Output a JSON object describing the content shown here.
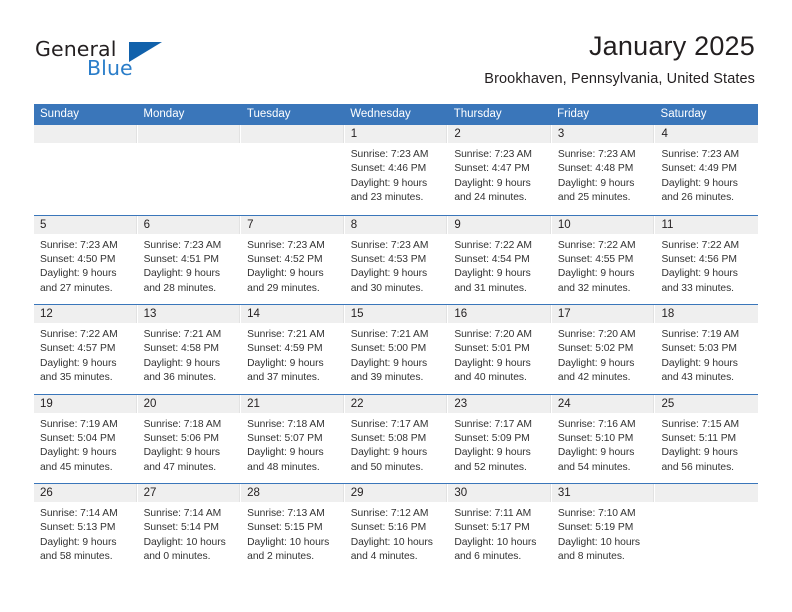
{
  "brand": {
    "name_part1": "General",
    "name_part2": "Blue",
    "logo_icon": "blue-triangle-icon",
    "color_dark": "#231f20",
    "color_blue": "#2a7dc9",
    "color_triangle": "#1161ab"
  },
  "header": {
    "title": "January 2025",
    "subtitle": "Brookhaven, Pennsylvania, United States"
  },
  "theme": {
    "header_blue": "#3a76ba",
    "daynum_band": "#efefef",
    "text": "#333333"
  },
  "calendar": {
    "weekday_headers": [
      "Sunday",
      "Monday",
      "Tuesday",
      "Wednesday",
      "Thursday",
      "Friday",
      "Saturday"
    ],
    "weeks": [
      [
        {
          "empty": true
        },
        {
          "empty": true
        },
        {
          "empty": true
        },
        {
          "day": "1",
          "sunrise": "Sunrise: 7:23 AM",
          "sunset": "Sunset: 4:46 PM",
          "daylight1": "Daylight: 9 hours",
          "daylight2": "and 23 minutes."
        },
        {
          "day": "2",
          "sunrise": "Sunrise: 7:23 AM",
          "sunset": "Sunset: 4:47 PM",
          "daylight1": "Daylight: 9 hours",
          "daylight2": "and 24 minutes."
        },
        {
          "day": "3",
          "sunrise": "Sunrise: 7:23 AM",
          "sunset": "Sunset: 4:48 PM",
          "daylight1": "Daylight: 9 hours",
          "daylight2": "and 25 minutes."
        },
        {
          "day": "4",
          "sunrise": "Sunrise: 7:23 AM",
          "sunset": "Sunset: 4:49 PM",
          "daylight1": "Daylight: 9 hours",
          "daylight2": "and 26 minutes."
        }
      ],
      [
        {
          "day": "5",
          "sunrise": "Sunrise: 7:23 AM",
          "sunset": "Sunset: 4:50 PM",
          "daylight1": "Daylight: 9 hours",
          "daylight2": "and 27 minutes."
        },
        {
          "day": "6",
          "sunrise": "Sunrise: 7:23 AM",
          "sunset": "Sunset: 4:51 PM",
          "daylight1": "Daylight: 9 hours",
          "daylight2": "and 28 minutes."
        },
        {
          "day": "7",
          "sunrise": "Sunrise: 7:23 AM",
          "sunset": "Sunset: 4:52 PM",
          "daylight1": "Daylight: 9 hours",
          "daylight2": "and 29 minutes."
        },
        {
          "day": "8",
          "sunrise": "Sunrise: 7:23 AM",
          "sunset": "Sunset: 4:53 PM",
          "daylight1": "Daylight: 9 hours",
          "daylight2": "and 30 minutes."
        },
        {
          "day": "9",
          "sunrise": "Sunrise: 7:22 AM",
          "sunset": "Sunset: 4:54 PM",
          "daylight1": "Daylight: 9 hours",
          "daylight2": "and 31 minutes."
        },
        {
          "day": "10",
          "sunrise": "Sunrise: 7:22 AM",
          "sunset": "Sunset: 4:55 PM",
          "daylight1": "Daylight: 9 hours",
          "daylight2": "and 32 minutes."
        },
        {
          "day": "11",
          "sunrise": "Sunrise: 7:22 AM",
          "sunset": "Sunset: 4:56 PM",
          "daylight1": "Daylight: 9 hours",
          "daylight2": "and 33 minutes."
        }
      ],
      [
        {
          "day": "12",
          "sunrise": "Sunrise: 7:22 AM",
          "sunset": "Sunset: 4:57 PM",
          "daylight1": "Daylight: 9 hours",
          "daylight2": "and 35 minutes."
        },
        {
          "day": "13",
          "sunrise": "Sunrise: 7:21 AM",
          "sunset": "Sunset: 4:58 PM",
          "daylight1": "Daylight: 9 hours",
          "daylight2": "and 36 minutes."
        },
        {
          "day": "14",
          "sunrise": "Sunrise: 7:21 AM",
          "sunset": "Sunset: 4:59 PM",
          "daylight1": "Daylight: 9 hours",
          "daylight2": "and 37 minutes."
        },
        {
          "day": "15",
          "sunrise": "Sunrise: 7:21 AM",
          "sunset": "Sunset: 5:00 PM",
          "daylight1": "Daylight: 9 hours",
          "daylight2": "and 39 minutes."
        },
        {
          "day": "16",
          "sunrise": "Sunrise: 7:20 AM",
          "sunset": "Sunset: 5:01 PM",
          "daylight1": "Daylight: 9 hours",
          "daylight2": "and 40 minutes."
        },
        {
          "day": "17",
          "sunrise": "Sunrise: 7:20 AM",
          "sunset": "Sunset: 5:02 PM",
          "daylight1": "Daylight: 9 hours",
          "daylight2": "and 42 minutes."
        },
        {
          "day": "18",
          "sunrise": "Sunrise: 7:19 AM",
          "sunset": "Sunset: 5:03 PM",
          "daylight1": "Daylight: 9 hours",
          "daylight2": "and 43 minutes."
        }
      ],
      [
        {
          "day": "19",
          "sunrise": "Sunrise: 7:19 AM",
          "sunset": "Sunset: 5:04 PM",
          "daylight1": "Daylight: 9 hours",
          "daylight2": "and 45 minutes."
        },
        {
          "day": "20",
          "sunrise": "Sunrise: 7:18 AM",
          "sunset": "Sunset: 5:06 PM",
          "daylight1": "Daylight: 9 hours",
          "daylight2": "and 47 minutes."
        },
        {
          "day": "21",
          "sunrise": "Sunrise: 7:18 AM",
          "sunset": "Sunset: 5:07 PM",
          "daylight1": "Daylight: 9 hours",
          "daylight2": "and 48 minutes."
        },
        {
          "day": "22",
          "sunrise": "Sunrise: 7:17 AM",
          "sunset": "Sunset: 5:08 PM",
          "daylight1": "Daylight: 9 hours",
          "daylight2": "and 50 minutes."
        },
        {
          "day": "23",
          "sunrise": "Sunrise: 7:17 AM",
          "sunset": "Sunset: 5:09 PM",
          "daylight1": "Daylight: 9 hours",
          "daylight2": "and 52 minutes."
        },
        {
          "day": "24",
          "sunrise": "Sunrise: 7:16 AM",
          "sunset": "Sunset: 5:10 PM",
          "daylight1": "Daylight: 9 hours",
          "daylight2": "and 54 minutes."
        },
        {
          "day": "25",
          "sunrise": "Sunrise: 7:15 AM",
          "sunset": "Sunset: 5:11 PM",
          "daylight1": "Daylight: 9 hours",
          "daylight2": "and 56 minutes."
        }
      ],
      [
        {
          "day": "26",
          "sunrise": "Sunrise: 7:14 AM",
          "sunset": "Sunset: 5:13 PM",
          "daylight1": "Daylight: 9 hours",
          "daylight2": "and 58 minutes."
        },
        {
          "day": "27",
          "sunrise": "Sunrise: 7:14 AM",
          "sunset": "Sunset: 5:14 PM",
          "daylight1": "Daylight: 10 hours",
          "daylight2": "and 0 minutes."
        },
        {
          "day": "28",
          "sunrise": "Sunrise: 7:13 AM",
          "sunset": "Sunset: 5:15 PM",
          "daylight1": "Daylight: 10 hours",
          "daylight2": "and 2 minutes."
        },
        {
          "day": "29",
          "sunrise": "Sunrise: 7:12 AM",
          "sunset": "Sunset: 5:16 PM",
          "daylight1": "Daylight: 10 hours",
          "daylight2": "and 4 minutes."
        },
        {
          "day": "30",
          "sunrise": "Sunrise: 7:11 AM",
          "sunset": "Sunset: 5:17 PM",
          "daylight1": "Daylight: 10 hours",
          "daylight2": "and 6 minutes."
        },
        {
          "day": "31",
          "sunrise": "Sunrise: 7:10 AM",
          "sunset": "Sunset: 5:19 PM",
          "daylight1": "Daylight: 10 hours",
          "daylight2": "and 8 minutes."
        },
        {
          "empty": true
        }
      ]
    ]
  }
}
